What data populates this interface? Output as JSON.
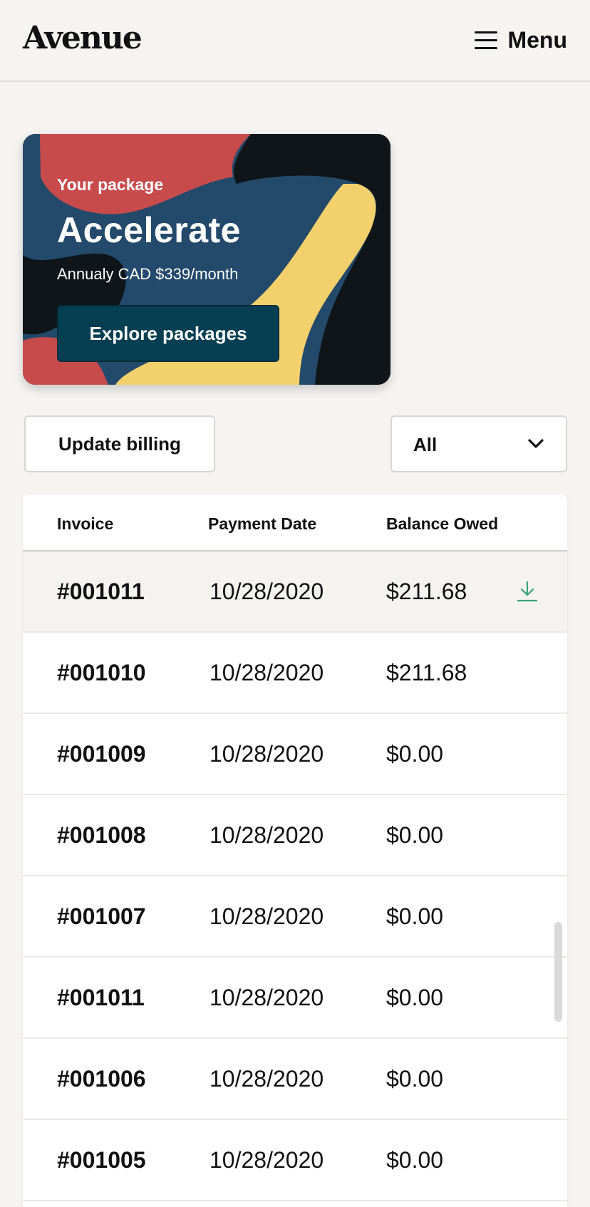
{
  "header": {
    "logo": "Avenue",
    "menu_label": "Menu"
  },
  "package": {
    "label": "Your package",
    "name": "Accelerate",
    "price": "Annualy CAD $339/month",
    "cta": "Explore packages"
  },
  "actions": {
    "update_billing": "Update billing",
    "filter_value": "All"
  },
  "table": {
    "columns": [
      "Invoice",
      "Payment Date",
      "Balance Owed"
    ],
    "rows": [
      {
        "invoice": "#001011",
        "date": "10/28/2020",
        "balance": "$211.68"
      },
      {
        "invoice": "#001010",
        "date": "10/28/2020",
        "balance": "$211.68"
      },
      {
        "invoice": "#001009",
        "date": "10/28/2020",
        "balance": "$0.00"
      },
      {
        "invoice": "#001008",
        "date": "10/28/2020",
        "balance": "$0.00"
      },
      {
        "invoice": "#001007",
        "date": "10/28/2020",
        "balance": "$0.00"
      },
      {
        "invoice": "#001011",
        "date": "10/28/2020",
        "balance": "$0.00"
      },
      {
        "invoice": "#001006",
        "date": "10/28/2020",
        "balance": "$0.00"
      },
      {
        "invoice": "#001005",
        "date": "10/28/2020",
        "balance": "$0.00"
      }
    ]
  },
  "colors": {
    "accent_button": "#063f52",
    "download_icon": "#3aa37a",
    "card_red": "#c84b4c",
    "card_blue": "#234a6b",
    "card_yellow": "#f2d06b",
    "card_dark": "#0f1518"
  },
  "icons": {
    "menu": "hamburger-icon",
    "filter": "chevron-down-icon",
    "download": "download-icon"
  }
}
